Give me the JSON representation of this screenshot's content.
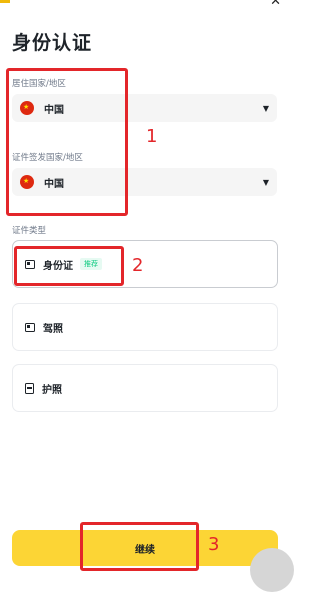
{
  "title": "身份认证",
  "residence": {
    "label": "居住国家/地区",
    "value": "中国"
  },
  "issuing": {
    "label": "证件签发国家/地区",
    "value": "中国"
  },
  "doc_type": {
    "label": "证件类型",
    "options": [
      {
        "label": "身份证",
        "badge": "推荐"
      },
      {
        "label": "驾照"
      },
      {
        "label": "护照"
      }
    ]
  },
  "continue_label": "继续",
  "annotations": [
    "1",
    "2",
    "3"
  ],
  "colors": {
    "accent": "#fcd535",
    "badge_green": "#0ecb81",
    "annotation_red": "#e3262a"
  },
  "icons": [
    "close-icon",
    "china-flag-icon",
    "chevron-down-icon",
    "id-card-icon",
    "driver-license-icon",
    "passport-icon"
  ]
}
